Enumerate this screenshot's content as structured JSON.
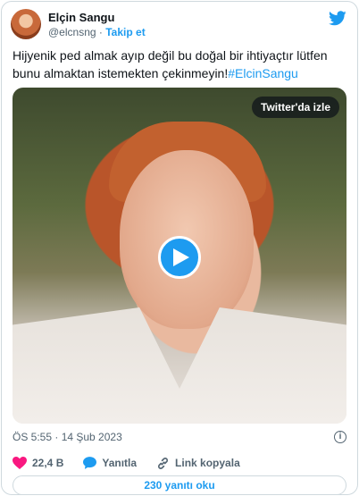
{
  "author": {
    "name": "Elçin Sangu",
    "handle": "@elcnsng",
    "separator": "·",
    "follow_label": "Takip et"
  },
  "tweet": {
    "text": "Hijyenik ped almak ayıp değil bu doğal bir ihtiyaçtır lütfen bunu almaktan istemekten çekinmeyin!",
    "hashtag": "#ElcinSangu",
    "timestamp": "ÖS 5:55 · 14 Şub 2023"
  },
  "media": {
    "watch_label": "Twitter'da izle"
  },
  "actions": {
    "likes": "22,4 B",
    "reply_label": "Yanıtla",
    "copy_link_label": "Link kopyala"
  },
  "footer": {
    "read_replies_label": "230 yanıtı oku"
  },
  "colors": {
    "accent": "#1d9bf0",
    "like": "#f91880",
    "muted": "#536471"
  },
  "icons": [
    "twitter-bird-icon",
    "play-icon",
    "info-icon",
    "heart-icon",
    "reply-icon",
    "link-icon"
  ]
}
